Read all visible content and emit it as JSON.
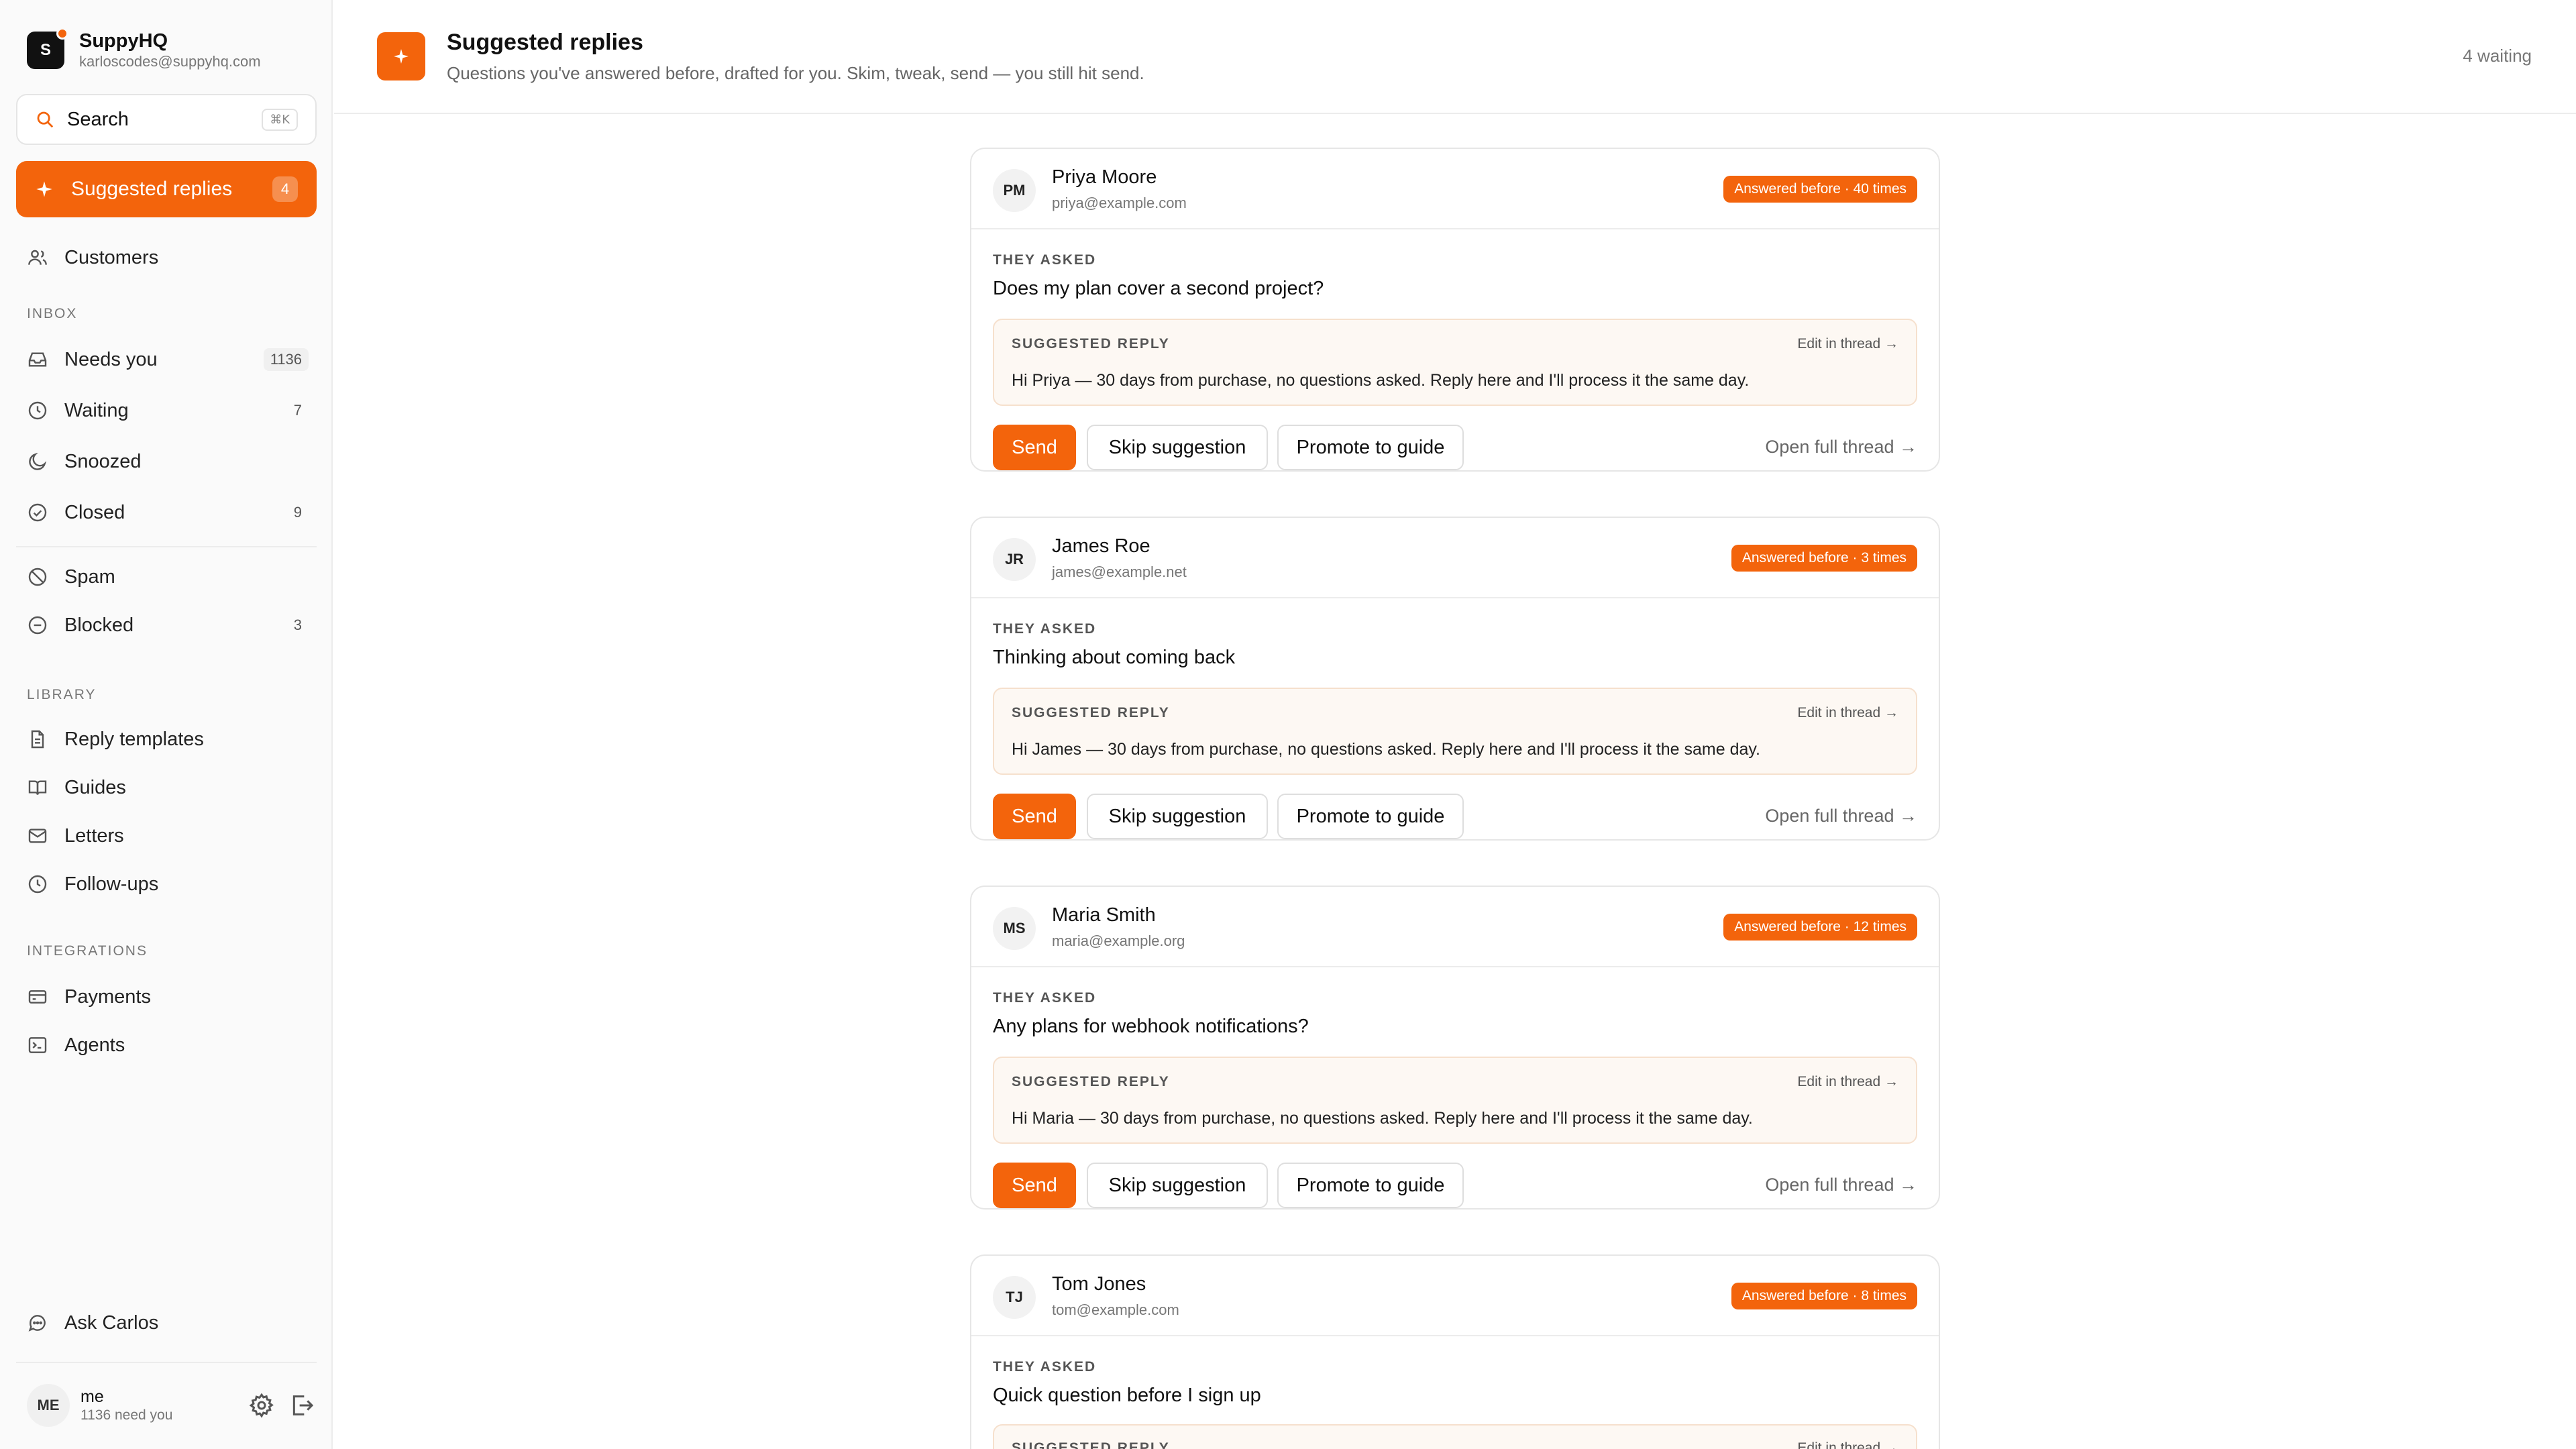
{
  "app": {
    "name": "SuppyHQ",
    "logo_letter": "S",
    "email": "karloscodes@suppyhq.com"
  },
  "search": {
    "label": "Search",
    "shortcut": "⌘K"
  },
  "nav_active": {
    "label": "Suggested replies",
    "count": "4"
  },
  "nav": {
    "customers": "Customers",
    "inbox_section": "INBOX",
    "needs_you": {
      "label": "Needs you",
      "count": "1136"
    },
    "waiting": {
      "label": "Waiting",
      "count": "7"
    },
    "snoozed": {
      "label": "Snoozed"
    },
    "closed": {
      "label": "Closed",
      "count": "9"
    },
    "spam": {
      "label": "Spam"
    },
    "blocked": {
      "label": "Blocked",
      "count": "3"
    },
    "library_section": "LIBRARY",
    "reply_templates": "Reply templates",
    "guides": "Guides",
    "letters": "Letters",
    "follow_ups": "Follow-ups",
    "integrations_section": "INTEGRATIONS",
    "payments": "Payments",
    "agents": "Agents",
    "ask": "Ask Carlos"
  },
  "user": {
    "initials": "ME",
    "name": "me",
    "sub": "1136 need you"
  },
  "header": {
    "title": "Suggested replies",
    "subtitle": "Questions you've answered before, drafted for you. Skim, tweak, send — you still hit send.",
    "waiting": "4 waiting"
  },
  "labels": {
    "they_asked": "THEY ASKED",
    "suggested_reply": "SUGGESTED REPLY",
    "edit_in_thread": "Edit in thread →",
    "send": "Send",
    "skip": "Skip suggestion",
    "promote": "Promote to guide",
    "open_thread": "Open full thread →"
  },
  "cards": [
    {
      "initials": "PM",
      "name": "Priya Moore",
      "email": "priya@example.com",
      "badge": "Answered before · 40 times",
      "question": "Does my plan cover a second project?",
      "reply": "Hi Priya — 30 days from purchase, no questions asked. Reply here and I'll process it the same day."
    },
    {
      "initials": "JR",
      "name": "James Roe",
      "email": "james@example.net",
      "badge": "Answered before · 3 times",
      "question": "Thinking about coming back",
      "reply": "Hi James — 30 days from purchase, no questions asked. Reply here and I'll process it the same day."
    },
    {
      "initials": "MS",
      "name": "Maria Smith",
      "email": "maria@example.org",
      "badge": "Answered before · 12 times",
      "question": "Any plans for webhook notifications?",
      "reply": "Hi Maria — 30 days from purchase, no questions asked. Reply here and I'll process it the same day."
    },
    {
      "initials": "TJ",
      "name": "Tom Jones",
      "email": "tom@example.com",
      "badge": "Answered before · 8 times",
      "question": "Quick question before I sign up",
      "reply": ""
    }
  ],
  "colors": {
    "accent": "#f3640c",
    "reply_bg": "#fdf8f3"
  }
}
